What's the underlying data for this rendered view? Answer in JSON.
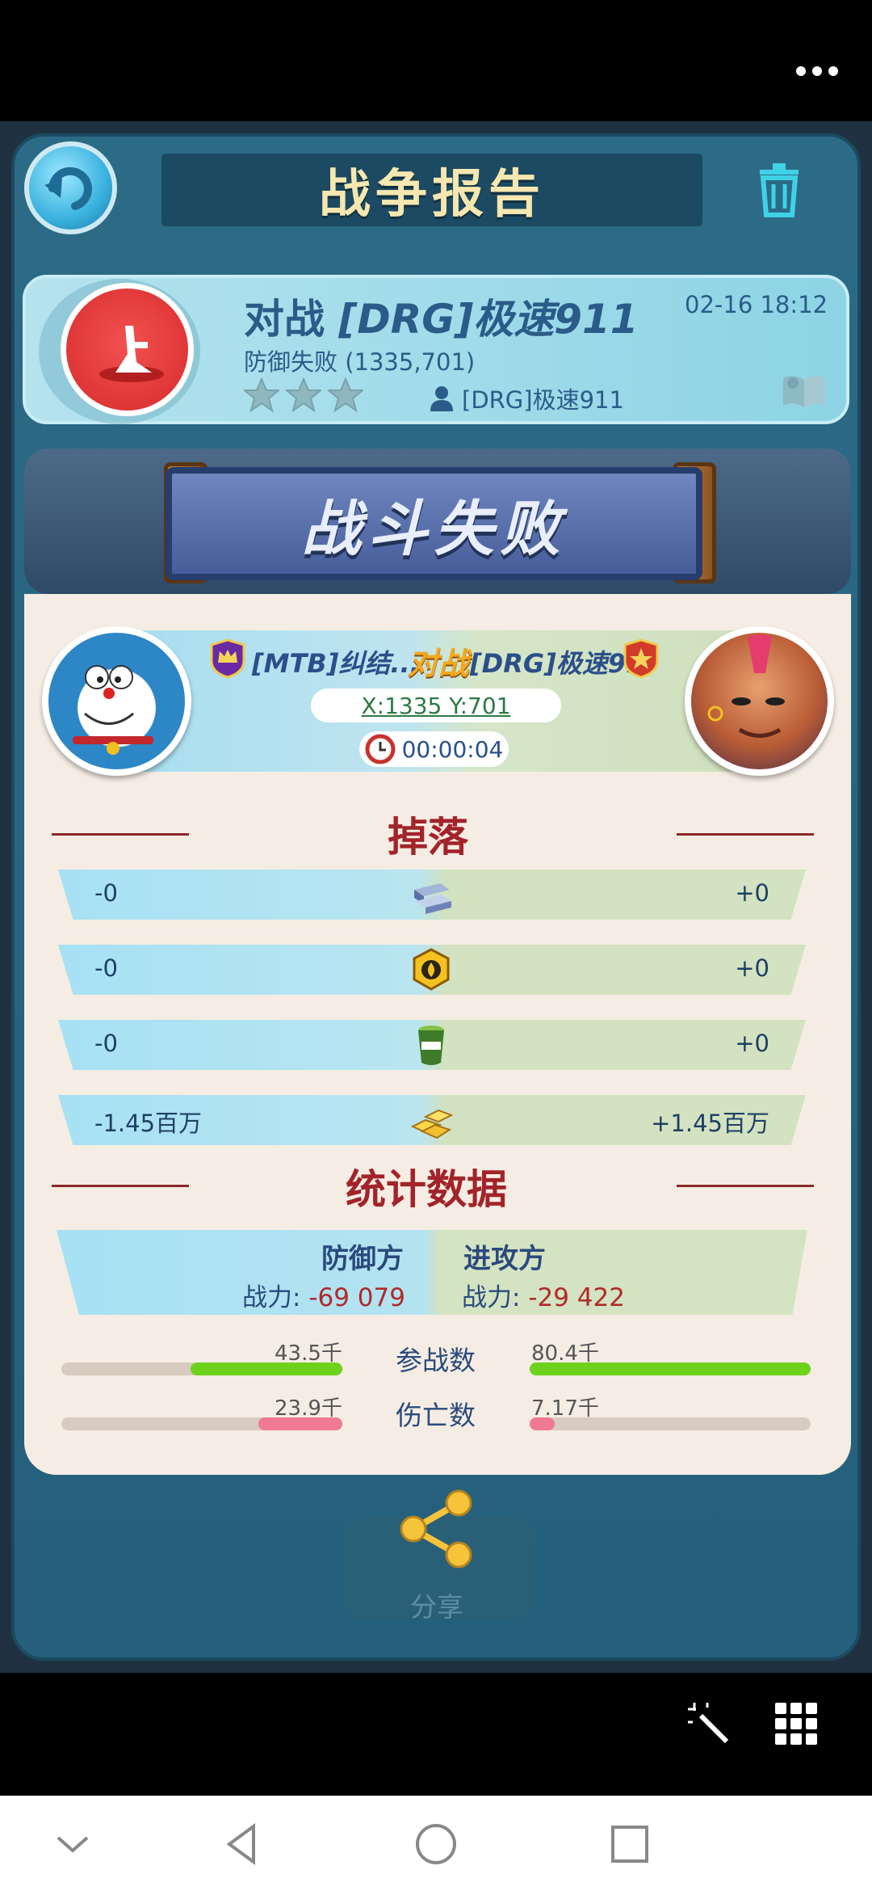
{
  "header": {
    "title": "战争报告"
  },
  "report": {
    "vs_prefix": "对战",
    "opponent": "[DRG]极速911",
    "time": "02-16 18:12",
    "result": "防御失败 (1335,701)",
    "player": "[DRG]极速911",
    "stars_earned": 0,
    "stars_total": 3
  },
  "banner": {
    "text": "战斗失败"
  },
  "battle": {
    "left_name": "[MTB]纠结...",
    "vs_label": "对战",
    "right_name": "[DRG]极速9...",
    "coords": "X:1335 Y:701",
    "duration": "00:00:04"
  },
  "drops": {
    "title": "掉落",
    "rows": [
      {
        "icon": "steel-icon",
        "left": "-0",
        "right": "+0"
      },
      {
        "icon": "oil-icon",
        "left": "-0",
        "right": "+0"
      },
      {
        "icon": "food-icon",
        "left": "-0",
        "right": "+0"
      },
      {
        "icon": "gold-icon",
        "left": "-1.45百万",
        "right": "+1.45百万"
      }
    ]
  },
  "stats": {
    "title": "统计数据",
    "defender_label": "防御方",
    "attacker_label": "进攻方",
    "defender_power_label": "战力: ",
    "defender_power": "-69 079",
    "attacker_power_label": "战力: ",
    "attacker_power": "-29 422",
    "troops": {
      "label": "参战数",
      "left": "43.5千",
      "right": "80.4千",
      "left_fraction": 0.54,
      "right_fraction": 1.0,
      "color": "#6cd21c"
    },
    "casualties": {
      "label": "伤亡数",
      "left": "23.9千",
      "right": "7.17千",
      "left_fraction": 0.3,
      "right_fraction": 0.09,
      "color": "#f07a93"
    }
  },
  "share": {
    "label": "分享"
  }
}
